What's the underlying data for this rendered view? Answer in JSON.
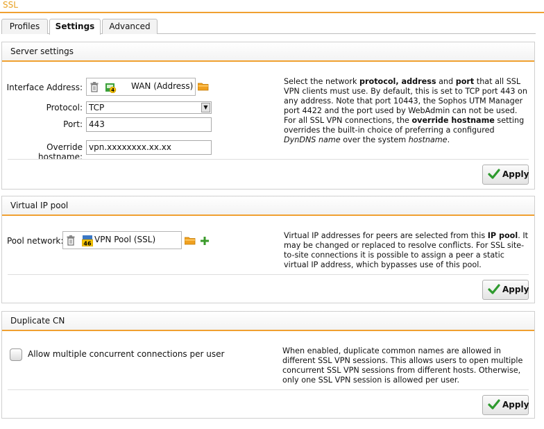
{
  "header": {
    "title": "SSL"
  },
  "tabs": [
    {
      "label": "Profiles",
      "active": false
    },
    {
      "label": "Settings",
      "active": true
    },
    {
      "label": "Advanced",
      "active": false
    }
  ],
  "server_settings": {
    "title": "Server settings",
    "interface_label": "Interface Address:",
    "interface_value": "WAN (Address)",
    "protocol_label": "Protocol:",
    "protocol_value": "TCP",
    "port_label": "Port:",
    "port_value": "443",
    "hostname_label": "Override hostname:",
    "hostname_value": "vpn.xxxxxxxx.xx.xx",
    "help": {
      "p1_a": "Select the network ",
      "p1_b1": "protocol, address",
      "p1_c": " and ",
      "p1_b2": "port",
      "p1_d": " that all SSL VPN clients must use. By default, this is set to TCP port 443 on any address. Note that port 10443, the Sophos UTM Manager port 4422 and the port used by WebAdmin can not be used.",
      "p2_a": "For all SSL VPN connections, the ",
      "p2_b": "override hostname",
      "p2_c": " setting overrides the built-in choice of preferring a configured ",
      "p2_i1": "DynDNS name",
      "p2_d": " over the system ",
      "p2_i2": "hostname",
      "p2_e": "."
    },
    "apply_label": "Apply"
  },
  "virtual_ip_pool": {
    "title": "Virtual IP pool",
    "pool_label": "Pool network:",
    "pool_value": "VPN Pool (SSL)",
    "help": {
      "a": "Virtual IP addresses for peers are selected from this ",
      "b": "IP pool",
      "c": ". It may be changed or replaced to resolve conflicts. For SSL site-to-site connections it is possible to assign a peer a static virtual IP address, which bypasses use of this pool."
    },
    "apply_label": "Apply"
  },
  "duplicate_cn": {
    "title": "Duplicate CN",
    "checkbox_label": "Allow multiple concurrent connections per user",
    "checked": false,
    "help": "When enabled, duplicate common names are allowed in different SSL VPN sessions. This allows users to open multiple concurrent SSL VPN sessions from different hosts. Otherwise, only one SSL VPN session is allowed per user.",
    "apply_label": "Apply"
  },
  "colors": {
    "accent": "#f0a030",
    "title": "#e8a020",
    "apply_check": "#2e9a2e",
    "folder": "#f0a020",
    "plus": "#3a9a2a"
  },
  "icons": [
    "trash-icon",
    "network-address-icon",
    "folder-icon",
    "network-pool-icon",
    "plus-icon",
    "check-icon"
  ]
}
